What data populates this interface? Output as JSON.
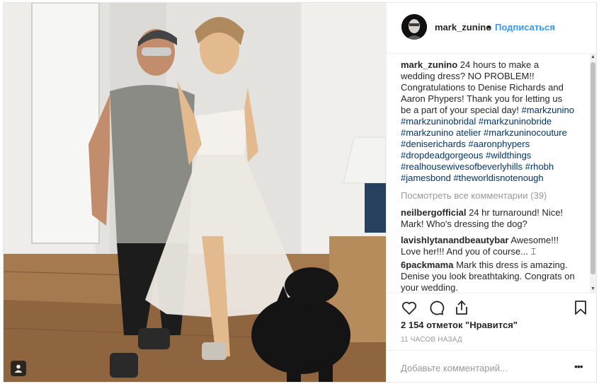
{
  "post": {
    "username": "mark_zunino",
    "separator": "•",
    "follow_label": "Подписаться",
    "caption_user": "mark_zunino",
    "caption_text": " 24 hours to make a wedding dress? NO PROBLEM!! Congratulations to Denise Richards and Aaron Phypers! Thank you for letting us be a part of your special day! ",
    "caption_tags": "#markzunino #markzuninobridal #markzuninobride #markzunino atelier #markzuninocouture #deniserichards #aaronphypers #dropdeadgorgeous #wildthings #realhousewivesofbeverlyhills #rhobh #jamesbond #theworldisnotenough",
    "view_all_comments": "Посмотреть все комментарии (39)",
    "comments": [
      {
        "user": "neilbergofficial",
        "text": " 24 hr turnaround! Nice! Mark! Who's dressing the dog?"
      },
      {
        "user": "lavishlytanandbeautybar",
        "text": " Awesome!!! Love her!!! And you of course... ⌶"
      },
      {
        "user": "6packmama",
        "text": " Mark this dress is amazing. Denise you look breathtaking. Congrats on your wedding."
      }
    ],
    "likes": "2 154 отметок \"Нравится\"",
    "time": "11 ЧАСОВ НАЗАД",
    "add_comment_placeholder": "Добавьте комментарий...",
    "more_label": "•••"
  },
  "icons": {
    "like": "heart-icon",
    "comment": "comment-icon",
    "share": "share-icon",
    "save": "bookmark-icon",
    "tag": "user-tag-icon"
  },
  "colors": {
    "link": "#3897f0",
    "hashtag": "#003569",
    "muted": "#999999",
    "text": "#262626"
  }
}
